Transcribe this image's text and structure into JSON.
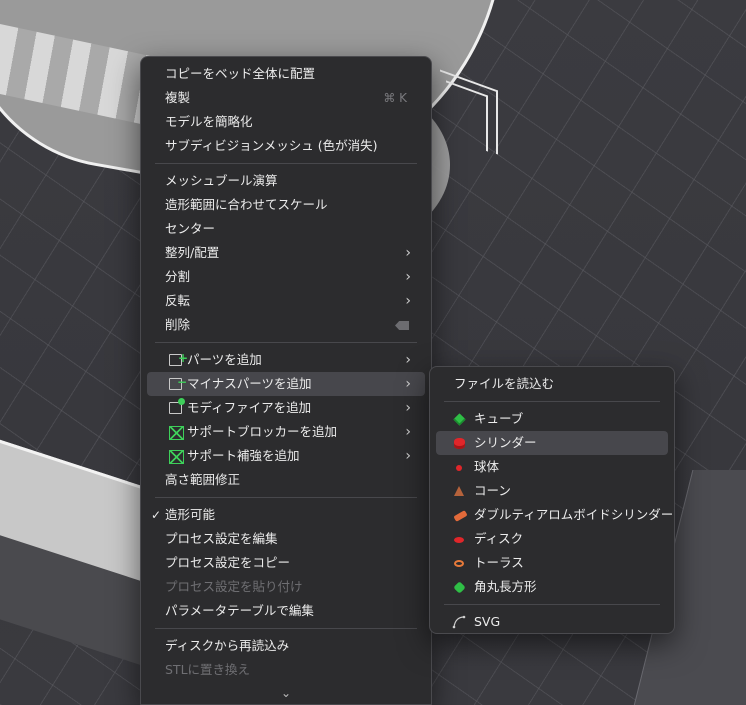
{
  "context_menu": {
    "items": [
      {
        "label": "コピーをベッド全体に配置"
      },
      {
        "label": "複製",
        "shortcut": "⌘ K"
      },
      {
        "label": "モデルを簡略化"
      },
      {
        "label": "サブディビジョンメッシュ (色が消失)"
      },
      {
        "label": "メッシュブール演算"
      },
      {
        "label": "造形範囲に合わせてスケール"
      },
      {
        "label": "センター"
      },
      {
        "label": "整列/配置"
      },
      {
        "label": "分割"
      },
      {
        "label": "反転"
      },
      {
        "label": "削除"
      },
      {
        "label": "パーツを追加"
      },
      {
        "label": "マイナスパーツを追加"
      },
      {
        "label": "モディファイアを追加"
      },
      {
        "label": "サポートブロッカーを追加"
      },
      {
        "label": "サポート補強を追加"
      },
      {
        "label": "高さ範囲修正"
      },
      {
        "label": "造形可能",
        "checked": true
      },
      {
        "label": "プロセス設定を編集"
      },
      {
        "label": "プロセス設定をコピー"
      },
      {
        "label": "プロセス設定を貼り付け",
        "disabled": true
      },
      {
        "label": "パラメータテーブルで編集"
      },
      {
        "label": "ディスクから再読込み"
      },
      {
        "label": "STLに置き換え",
        "disabled": true
      }
    ],
    "more_indicator": "⌄"
  },
  "submenu": {
    "load_file": "ファイルを読込む",
    "shapes": [
      {
        "label": "キューブ",
        "icon": "cube-icon",
        "color": "#2fbf46"
      },
      {
        "label": "シリンダー",
        "icon": "cylinder-icon",
        "color": "#e0262a"
      },
      {
        "label": "球体",
        "icon": "sphere-icon",
        "color": "#e0262a"
      },
      {
        "label": "コーン",
        "icon": "cone-icon",
        "color": "#b5623b"
      },
      {
        "label": "ダブルティアロムボイドシリンダー",
        "icon": "double-teardrop-icon",
        "color": "#e26a3a"
      },
      {
        "label": "ディスク",
        "icon": "disc-icon",
        "color": "#e0262a"
      },
      {
        "label": "トーラス",
        "icon": "torus-icon",
        "color": "#e87a3a"
      },
      {
        "label": "角丸長方形",
        "icon": "rounded-rect-icon",
        "color": "#2fbf46"
      }
    ],
    "svg": "SVG"
  }
}
